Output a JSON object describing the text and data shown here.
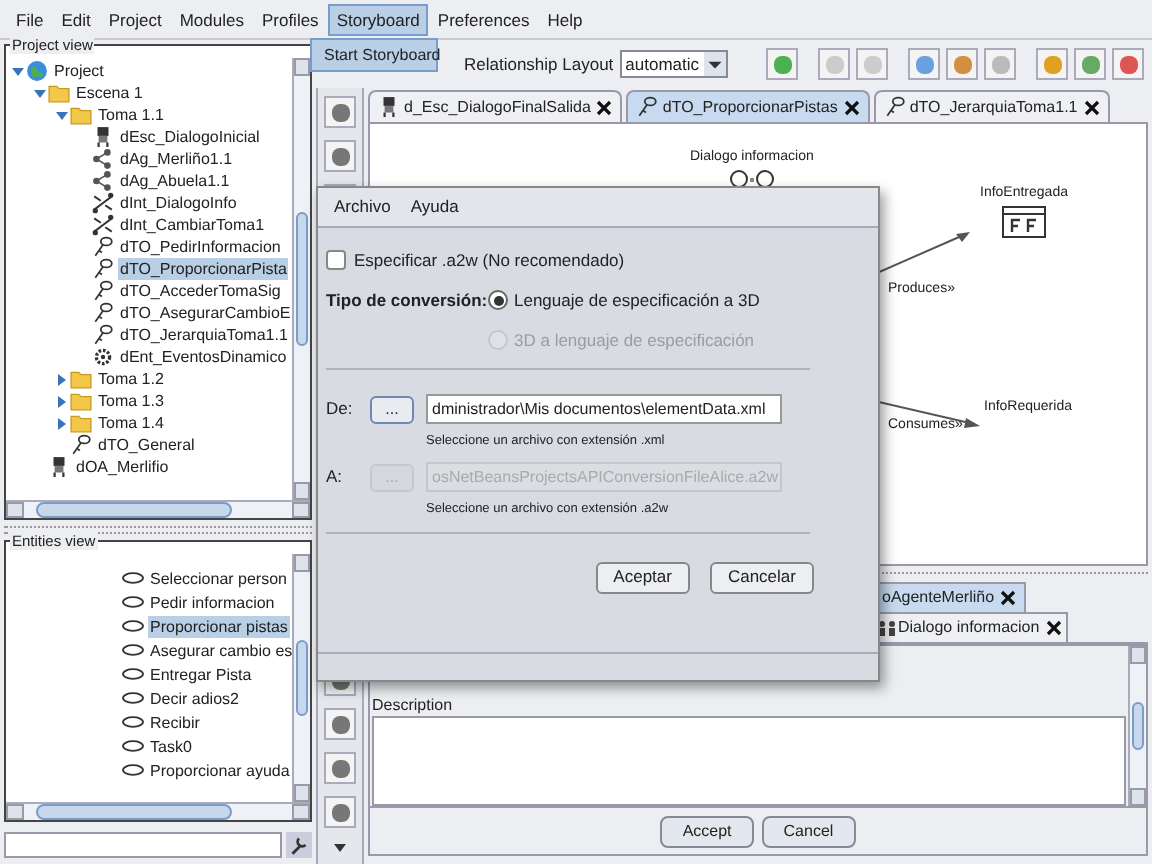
{
  "menubar": [
    {
      "label": "File",
      "selected": false
    },
    {
      "label": "Edit",
      "selected": false
    },
    {
      "label": "Project",
      "selected": false
    },
    {
      "label": "Modules",
      "selected": false
    },
    {
      "label": "Profiles",
      "selected": false
    },
    {
      "label": "Storyboard",
      "selected": true
    },
    {
      "label": "Preferences",
      "selected": false
    },
    {
      "label": "Help",
      "selected": false
    }
  ],
  "open_menu": {
    "items": [
      "Start Storyboard"
    ]
  },
  "project_view": {
    "title": "Project view",
    "tree": [
      {
        "label": "Project",
        "kind": "root",
        "expanded": true,
        "selected": false,
        "children": [
          {
            "label": "Escena 1",
            "kind": "folder",
            "expanded": true,
            "selected": false,
            "children": [
              {
                "label": "Toma 1.1",
                "kind": "folder",
                "expanded": true,
                "selected": false,
                "children": [
                  {
                    "label": "dEsc_DialogoInicial",
                    "kind": "scene",
                    "selected": false
                  },
                  {
                    "label": "dAg_Merliño1.1",
                    "kind": "agent",
                    "selected": false
                  },
                  {
                    "label": "dAg_Abuela1.1",
                    "kind": "agent",
                    "selected": false
                  },
                  {
                    "label": "dInt_DialogoInfo",
                    "kind": "interaction",
                    "selected": false
                  },
                  {
                    "label": "dInt_CambiarToma1",
                    "kind": "interaction",
                    "selected": false
                  },
                  {
                    "label": "dTO_PedirInformacion",
                    "kind": "task",
                    "selected": false
                  },
                  {
                    "label": "dTO_ProporcionarPista",
                    "kind": "task",
                    "selected": true
                  },
                  {
                    "label": "dTO_AccederTomaSig",
                    "kind": "task",
                    "selected": false
                  },
                  {
                    "label": "dTO_AsegurarCambioE",
                    "kind": "task",
                    "selected": false
                  },
                  {
                    "label": "dTO_JerarquiaToma1.1",
                    "kind": "task",
                    "selected": false
                  },
                  {
                    "label": "dEnt_EventosDinamico",
                    "kind": "event",
                    "selected": false
                  }
                ]
              },
              {
                "label": "Toma 1.2",
                "kind": "folder",
                "expanded": false,
                "selected": false
              },
              {
                "label": "Toma 1.3",
                "kind": "folder",
                "expanded": false,
                "selected": false
              },
              {
                "label": "Toma 1.4",
                "kind": "folder",
                "expanded": false,
                "selected": false
              },
              {
                "label": "dTO_General",
                "kind": "task",
                "selected": false
              }
            ]
          },
          {
            "label": "dOA_Merlifio",
            "kind": "scene",
            "selected": false
          }
        ]
      }
    ]
  },
  "entities_view": {
    "title": "Entities view",
    "items": [
      {
        "label": "Seleccionar person",
        "selected": false
      },
      {
        "label": "Pedir informacion",
        "selected": false
      },
      {
        "label": "Proporcionar pistas",
        "selected": true
      },
      {
        "label": "Asegurar cambio es",
        "selected": false
      },
      {
        "label": "Entregar Pista",
        "selected": false
      },
      {
        "label": "Decir adios2",
        "selected": false
      },
      {
        "label": "Recibir",
        "selected": false
      },
      {
        "label": "Task0",
        "selected": false
      },
      {
        "label": "Proporcionar ayuda",
        "selected": false
      }
    ]
  },
  "toolbar": {
    "layout_label": "Relationship Layout",
    "layout_value": "automatic"
  },
  "tabs": [
    {
      "label": "d_Esc_DialogoFinalSalida",
      "kind": "scene",
      "selected": false
    },
    {
      "label": "dTO_ProporcionarPistas",
      "kind": "task",
      "selected": true
    },
    {
      "label": "dTO_JerarquiaToma1.1",
      "kind": "task",
      "selected": false
    }
  ],
  "diagram": {
    "nodes": [
      {
        "label": "Dialogo informacion",
        "kind": "interaction"
      },
      {
        "label": "InfoEntregada",
        "kind": "fact"
      },
      {
        "label": "InfoRequerida",
        "kind": "fact"
      }
    ],
    "edges": [
      {
        "label": "Produces»"
      },
      {
        "label": "Consumes»"
      }
    ]
  },
  "bottom_tabs": [
    {
      "label": "oAgenteMerliño",
      "selected": true
    },
    {
      "label": "Dialogo informacion",
      "selected": false
    }
  ],
  "properties": {
    "description_label": "Description",
    "buttons": [
      "Accept",
      "Cancel"
    ]
  },
  "dialog": {
    "menu": [
      "Archivo",
      "Ayuda"
    ],
    "checkbox": {
      "label": "Especificar .a2w (No recomendado)",
      "checked": false
    },
    "conversion_label": "Tipo de conversión:",
    "options": [
      {
        "label": "Lenguaje de especificación a 3D",
        "selected": true,
        "disabled": false
      },
      {
        "label": "3D a lenguaje de especificación",
        "selected": false,
        "disabled": true
      }
    ],
    "files": [
      {
        "label": "De:",
        "browse": "...",
        "value": "dministrador\\Mis documentos\\elementData.xml",
        "hint": "Seleccione un archivo con extensión .xml",
        "disabled": false
      },
      {
        "label": "A:",
        "browse": "...",
        "value": "osNetBeansProjectsAPIConversionFileAlice.a2w",
        "hint": "Seleccione un archivo con extensión .a2w",
        "disabled": true
      }
    ],
    "buttons": [
      "Aceptar",
      "Cancelar"
    ]
  }
}
